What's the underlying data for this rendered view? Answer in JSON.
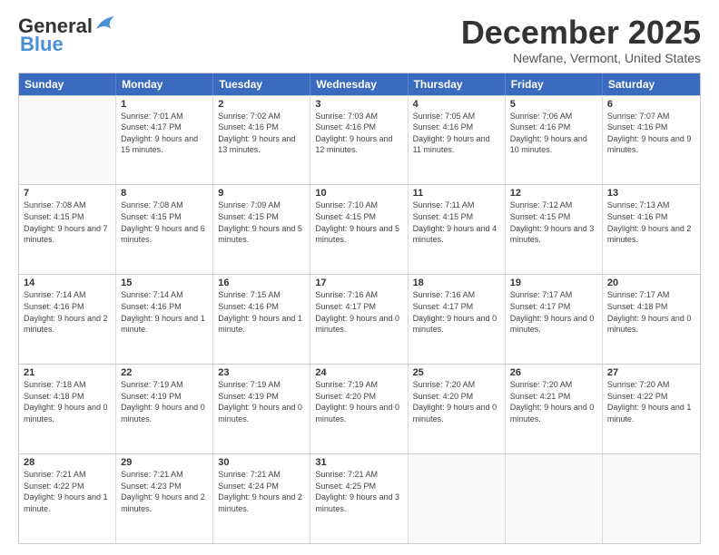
{
  "header": {
    "logo_general": "General",
    "logo_blue": "Blue",
    "month": "December 2025",
    "location": "Newfane, Vermont, United States"
  },
  "days_of_week": [
    "Sunday",
    "Monday",
    "Tuesday",
    "Wednesday",
    "Thursday",
    "Friday",
    "Saturday"
  ],
  "weeks": [
    [
      {
        "day": "",
        "sunrise": "",
        "sunset": "",
        "daylight": ""
      },
      {
        "day": "1",
        "sunrise": "Sunrise: 7:01 AM",
        "sunset": "Sunset: 4:17 PM",
        "daylight": "Daylight: 9 hours and 15 minutes."
      },
      {
        "day": "2",
        "sunrise": "Sunrise: 7:02 AM",
        "sunset": "Sunset: 4:16 PM",
        "daylight": "Daylight: 9 hours and 13 minutes."
      },
      {
        "day": "3",
        "sunrise": "Sunrise: 7:03 AM",
        "sunset": "Sunset: 4:16 PM",
        "daylight": "Daylight: 9 hours and 12 minutes."
      },
      {
        "day": "4",
        "sunrise": "Sunrise: 7:05 AM",
        "sunset": "Sunset: 4:16 PM",
        "daylight": "Daylight: 9 hours and 11 minutes."
      },
      {
        "day": "5",
        "sunrise": "Sunrise: 7:06 AM",
        "sunset": "Sunset: 4:16 PM",
        "daylight": "Daylight: 9 hours and 10 minutes."
      },
      {
        "day": "6",
        "sunrise": "Sunrise: 7:07 AM",
        "sunset": "Sunset: 4:16 PM",
        "daylight": "Daylight: 9 hours and 9 minutes."
      }
    ],
    [
      {
        "day": "7",
        "sunrise": "Sunrise: 7:08 AM",
        "sunset": "Sunset: 4:15 PM",
        "daylight": "Daylight: 9 hours and 7 minutes."
      },
      {
        "day": "8",
        "sunrise": "Sunrise: 7:08 AM",
        "sunset": "Sunset: 4:15 PM",
        "daylight": "Daylight: 9 hours and 6 minutes."
      },
      {
        "day": "9",
        "sunrise": "Sunrise: 7:09 AM",
        "sunset": "Sunset: 4:15 PM",
        "daylight": "Daylight: 9 hours and 5 minutes."
      },
      {
        "day": "10",
        "sunrise": "Sunrise: 7:10 AM",
        "sunset": "Sunset: 4:15 PM",
        "daylight": "Daylight: 9 hours and 5 minutes."
      },
      {
        "day": "11",
        "sunrise": "Sunrise: 7:11 AM",
        "sunset": "Sunset: 4:15 PM",
        "daylight": "Daylight: 9 hours and 4 minutes."
      },
      {
        "day": "12",
        "sunrise": "Sunrise: 7:12 AM",
        "sunset": "Sunset: 4:15 PM",
        "daylight": "Daylight: 9 hours and 3 minutes."
      },
      {
        "day": "13",
        "sunrise": "Sunrise: 7:13 AM",
        "sunset": "Sunset: 4:16 PM",
        "daylight": "Daylight: 9 hours and 2 minutes."
      }
    ],
    [
      {
        "day": "14",
        "sunrise": "Sunrise: 7:14 AM",
        "sunset": "Sunset: 4:16 PM",
        "daylight": "Daylight: 9 hours and 2 minutes."
      },
      {
        "day": "15",
        "sunrise": "Sunrise: 7:14 AM",
        "sunset": "Sunset: 4:16 PM",
        "daylight": "Daylight: 9 hours and 1 minute."
      },
      {
        "day": "16",
        "sunrise": "Sunrise: 7:15 AM",
        "sunset": "Sunset: 4:16 PM",
        "daylight": "Daylight: 9 hours and 1 minute."
      },
      {
        "day": "17",
        "sunrise": "Sunrise: 7:16 AM",
        "sunset": "Sunset: 4:17 PM",
        "daylight": "Daylight: 9 hours and 0 minutes."
      },
      {
        "day": "18",
        "sunrise": "Sunrise: 7:16 AM",
        "sunset": "Sunset: 4:17 PM",
        "daylight": "Daylight: 9 hours and 0 minutes."
      },
      {
        "day": "19",
        "sunrise": "Sunrise: 7:17 AM",
        "sunset": "Sunset: 4:17 PM",
        "daylight": "Daylight: 9 hours and 0 minutes."
      },
      {
        "day": "20",
        "sunrise": "Sunrise: 7:17 AM",
        "sunset": "Sunset: 4:18 PM",
        "daylight": "Daylight: 9 hours and 0 minutes."
      }
    ],
    [
      {
        "day": "21",
        "sunrise": "Sunrise: 7:18 AM",
        "sunset": "Sunset: 4:18 PM",
        "daylight": "Daylight: 9 hours and 0 minutes."
      },
      {
        "day": "22",
        "sunrise": "Sunrise: 7:19 AM",
        "sunset": "Sunset: 4:19 PM",
        "daylight": "Daylight: 9 hours and 0 minutes."
      },
      {
        "day": "23",
        "sunrise": "Sunrise: 7:19 AM",
        "sunset": "Sunset: 4:19 PM",
        "daylight": "Daylight: 9 hours and 0 minutes."
      },
      {
        "day": "24",
        "sunrise": "Sunrise: 7:19 AM",
        "sunset": "Sunset: 4:20 PM",
        "daylight": "Daylight: 9 hours and 0 minutes."
      },
      {
        "day": "25",
        "sunrise": "Sunrise: 7:20 AM",
        "sunset": "Sunset: 4:20 PM",
        "daylight": "Daylight: 9 hours and 0 minutes."
      },
      {
        "day": "26",
        "sunrise": "Sunrise: 7:20 AM",
        "sunset": "Sunset: 4:21 PM",
        "daylight": "Daylight: 9 hours and 0 minutes."
      },
      {
        "day": "27",
        "sunrise": "Sunrise: 7:20 AM",
        "sunset": "Sunset: 4:22 PM",
        "daylight": "Daylight: 9 hours and 1 minute."
      }
    ],
    [
      {
        "day": "28",
        "sunrise": "Sunrise: 7:21 AM",
        "sunset": "Sunset: 4:22 PM",
        "daylight": "Daylight: 9 hours and 1 minute."
      },
      {
        "day": "29",
        "sunrise": "Sunrise: 7:21 AM",
        "sunset": "Sunset: 4:23 PM",
        "daylight": "Daylight: 9 hours and 2 minutes."
      },
      {
        "day": "30",
        "sunrise": "Sunrise: 7:21 AM",
        "sunset": "Sunset: 4:24 PM",
        "daylight": "Daylight: 9 hours and 2 minutes."
      },
      {
        "day": "31",
        "sunrise": "Sunrise: 7:21 AM",
        "sunset": "Sunset: 4:25 PM",
        "daylight": "Daylight: 9 hours and 3 minutes."
      },
      {
        "day": "",
        "sunrise": "",
        "sunset": "",
        "daylight": ""
      },
      {
        "day": "",
        "sunrise": "",
        "sunset": "",
        "daylight": ""
      },
      {
        "day": "",
        "sunrise": "",
        "sunset": "",
        "daylight": ""
      }
    ]
  ]
}
